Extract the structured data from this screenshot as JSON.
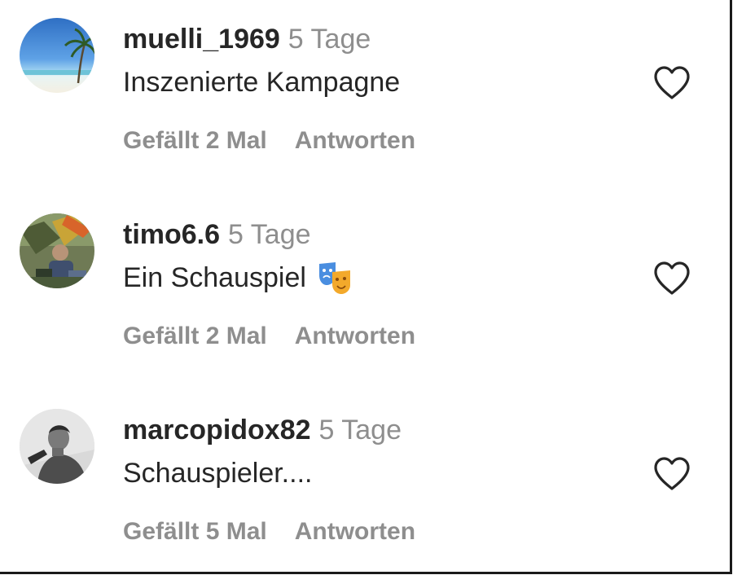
{
  "comments": [
    {
      "username": "muelli_1969",
      "time": "5 Tage",
      "text": "Inszenierte Kampagne",
      "likes": "Gefällt 2 Mal",
      "reply": "Antworten",
      "avatar": "beach-palm-avatar",
      "emoji": ""
    },
    {
      "username": "timo6.6",
      "time": "5 Tage",
      "text": "Ein Schauspiel",
      "likes": "Gefällt 2 Mal",
      "reply": "Antworten",
      "avatar": "outdoor-person-avatar",
      "emoji": "theater-masks-emoji"
    },
    {
      "username": "marcopidox82",
      "time": "5 Tage",
      "text": "Schauspieler....",
      "likes": "Gefällt 5 Mal",
      "reply": "Antworten",
      "avatar": "grayscale-portrait-avatar",
      "emoji": ""
    }
  ],
  "colors": {
    "primary_text": "#262626",
    "secondary_text": "#8e8e8e",
    "background": "#ffffff"
  }
}
